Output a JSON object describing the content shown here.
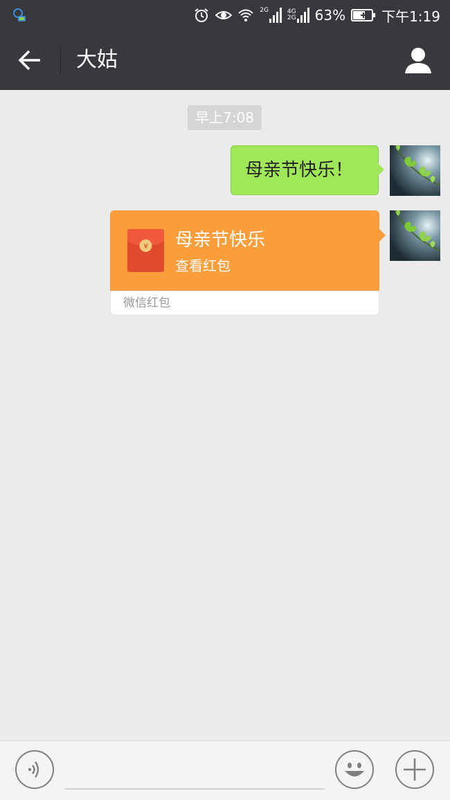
{
  "status_bar": {
    "battery_percent": "63%",
    "time": "下午1:19",
    "network_a": "2G",
    "network_b_top": "4G",
    "network_b_bottom": "2G"
  },
  "header": {
    "title": "大姑"
  },
  "chat": {
    "timestamp": "早上7:08",
    "messages": [
      {
        "type": "text",
        "text": "母亲节快乐！"
      },
      {
        "type": "red_packet",
        "title": "母亲节快乐",
        "subtitle": "查看红包",
        "footer": "微信红包",
        "symbol": "¥"
      }
    ]
  },
  "colors": {
    "header_bg": "#38393d",
    "chat_bg": "#ebebeb",
    "bubble_green": "#a0e759",
    "red_packet_orange": "#fa9d3b",
    "envelope_red": "#e04a2f"
  }
}
